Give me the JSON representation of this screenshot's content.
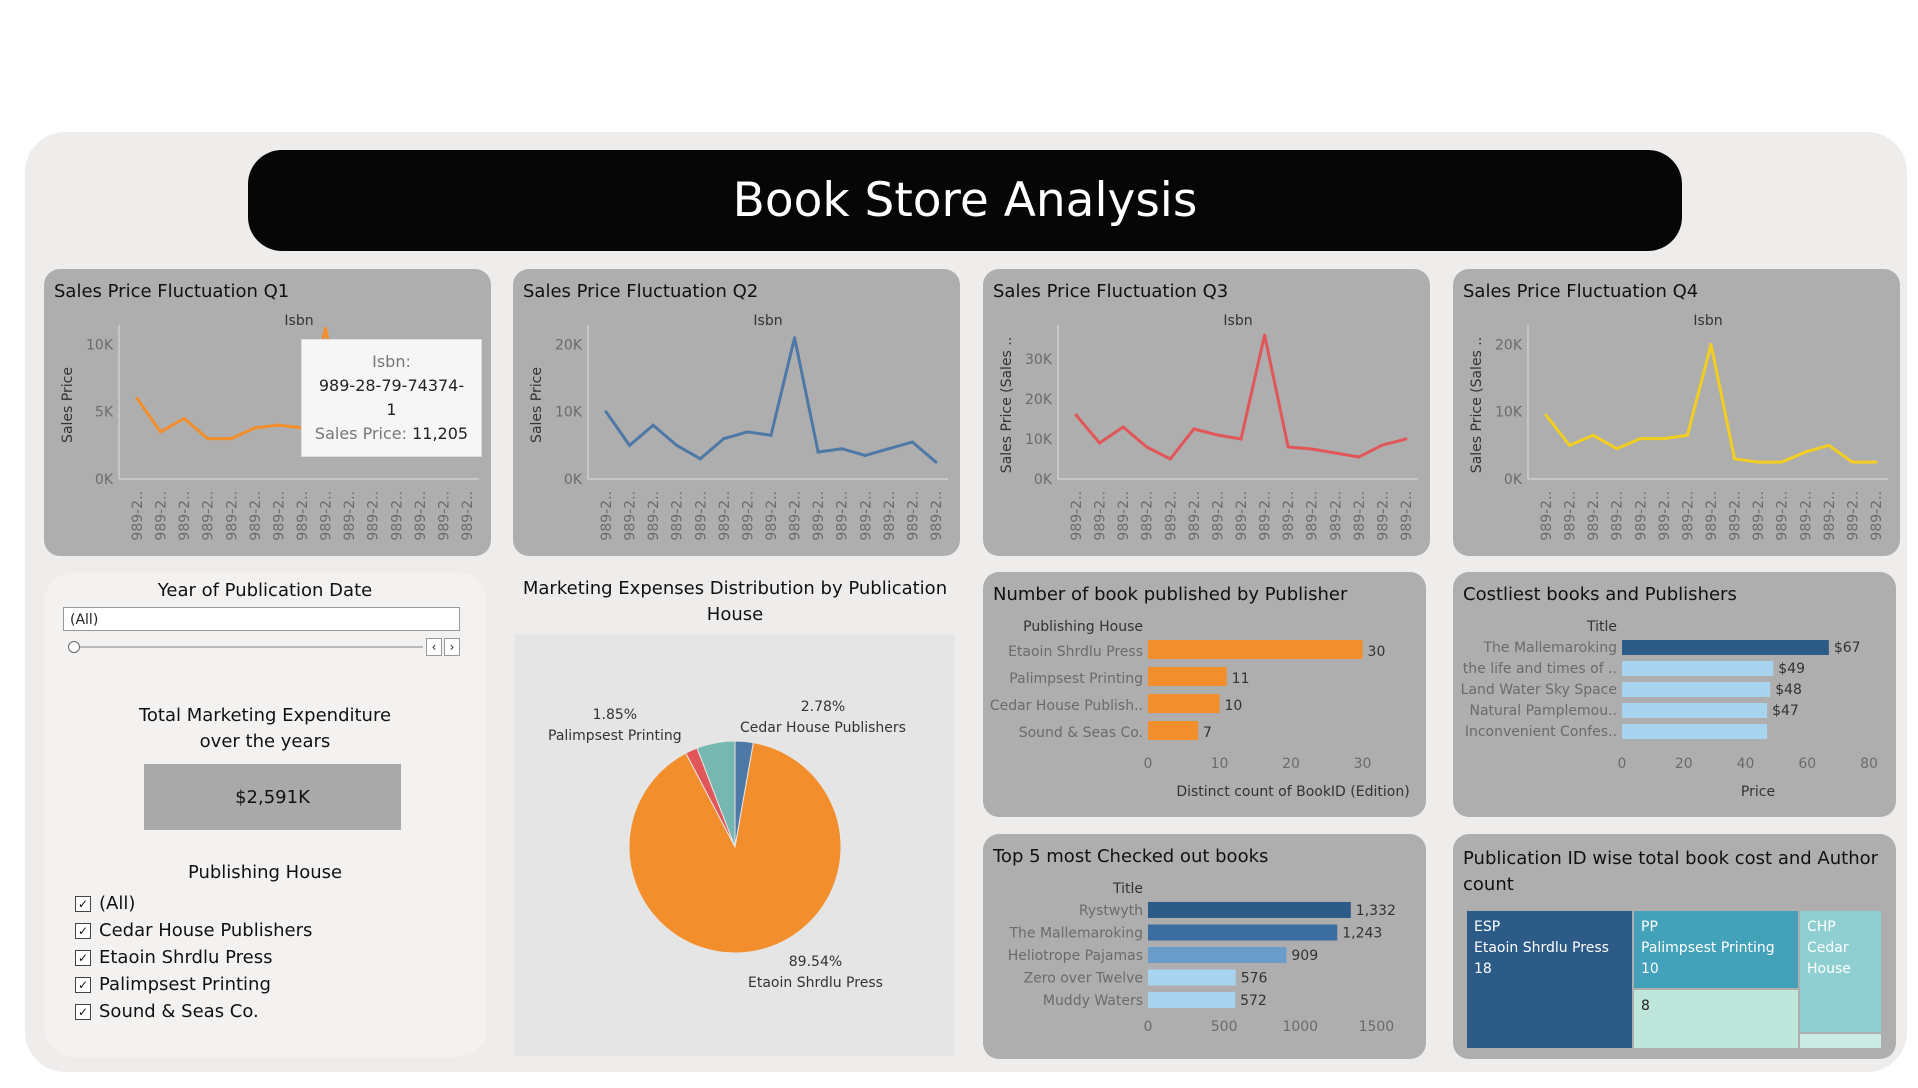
{
  "header": {
    "title": "Book Store Analysis"
  },
  "quarters": [
    {
      "title": "Sales Price Fluctuation  Q1",
      "xlabel": "Isbn",
      "ylabel": "Sales Price",
      "color": "#f28e2b",
      "ticks": [
        "10K",
        "5K",
        "0K"
      ],
      "ylim": [
        0,
        11000
      ],
      "tickvals": [
        10000,
        5000,
        0
      ],
      "values": [
        6000,
        3500,
        4500,
        3000,
        3000,
        3800,
        4000,
        3800,
        11205,
        2000,
        3000,
        2000,
        2500,
        2800,
        3200
      ],
      "xtick": "989-2.."
    },
    {
      "title": "Sales Price Fluctuation  Q2",
      "xlabel": "Isbn",
      "ylabel": "Sales Price",
      "color": "#4e79a7",
      "ticks": [
        "20K",
        "10K",
        "0K"
      ],
      "ylim": [
        0,
        22000
      ],
      "tickvals": [
        20000,
        10000,
        0
      ],
      "values": [
        10000,
        5000,
        8000,
        5000,
        3000,
        6000,
        7000,
        6500,
        21000,
        4000,
        4500,
        3500,
        4500,
        5500,
        2500
      ],
      "xtick": "989-2.."
    },
    {
      "title": "Sales Price Fluctuation Q3",
      "xlabel": "Isbn",
      "ylabel": "Sales Price (Sales ..",
      "color": "#e15759",
      "ticks": [
        "30K",
        "20K",
        "10K",
        "0K"
      ],
      "ylim": [
        0,
        37000
      ],
      "tickvals": [
        30000,
        20000,
        10000,
        0
      ],
      "values": [
        16000,
        9000,
        13000,
        8000,
        5000,
        12500,
        11000,
        10000,
        36000,
        8000,
        7500,
        6500,
        5500,
        8500,
        10000
      ],
      "xtick": "989-2.."
    },
    {
      "title": "Sales Price Fluctuation Q4",
      "xlabel": "Isbn",
      "ylabel": "Sales Price (Sales ..",
      "color": "#f1ce21",
      "ticks": [
        "20K",
        "10K",
        "0K"
      ],
      "ylim": [
        0,
        22000
      ],
      "tickvals": [
        20000,
        10000,
        0
      ],
      "values": [
        9500,
        5000,
        6500,
        4500,
        6000,
        6000,
        6500,
        20000,
        3000,
        2500,
        2500,
        4000,
        5000,
        2500,
        2500
      ],
      "xtick": "989-2.."
    }
  ],
  "tooltip": {
    "isbn_label": "Isbn:",
    "isbn_value": "989-28-79-74374-1",
    "price_label": "Sales Price:",
    "price_value": "11,205"
  },
  "filters": {
    "year_title": "Year of Publication Date",
    "year_value": "(All)",
    "total_title_1": "Total Marketing Expenditure",
    "total_title_2": "over the years",
    "total_value": "$2,591K",
    "publisher_title": "Publishing House",
    "publishers": [
      "(All)",
      "Cedar House Publishers",
      "Etaoin Shrdlu Press",
      "Palimpsest Printing",
      "Sound & Seas Co."
    ],
    "check_mark": "✓"
  },
  "pie": {
    "title_1": "Marketing Expenses Distribution by Publication",
    "title_2": "House",
    "labels": [
      {
        "pct": "2.78%",
        "name": "Cedar House Publishers"
      },
      {
        "pct": "1.85%",
        "name": "Palimpsest Printing"
      },
      {
        "pct": "89.54%",
        "name": "Etaoin Shrdlu Press"
      }
    ]
  },
  "chart_data": [
    {
      "type": "line",
      "title": "Sales Price Fluctuation  Q1",
      "xlabel": "Isbn",
      "ylabel": "Sales Price",
      "ylim": [
        0,
        11000
      ],
      "y": [
        6000,
        3500,
        4500,
        3000,
        3000,
        3800,
        4000,
        3800,
        11205,
        2000,
        3000,
        2000,
        2500,
        2800,
        3200
      ]
    },
    {
      "type": "line",
      "title": "Sales Price Fluctuation  Q2",
      "xlabel": "Isbn",
      "ylabel": "Sales Price",
      "ylim": [
        0,
        22000
      ],
      "y": [
        10000,
        5000,
        8000,
        5000,
        3000,
        6000,
        7000,
        6500,
        21000,
        4000,
        4500,
        3500,
        4500,
        5500,
        2500
      ]
    },
    {
      "type": "line",
      "title": "Sales Price Fluctuation Q3",
      "xlabel": "Isbn",
      "ylabel": "Sales Price (Sales ..",
      "ylim": [
        0,
        37000
      ],
      "y": [
        16000,
        9000,
        13000,
        8000,
        5000,
        12500,
        11000,
        10000,
        36000,
        8000,
        7500,
        6500,
        5500,
        8500,
        10000
      ]
    },
    {
      "type": "line",
      "title": "Sales Price Fluctuation Q4",
      "xlabel": "Isbn",
      "ylabel": "Sales Price (Sales ..",
      "ylim": [
        0,
        22000
      ],
      "y": [
        9500,
        5000,
        6500,
        4500,
        6000,
        6000,
        6500,
        20000,
        3000,
        2500,
        2500,
        4000,
        5000,
        2500,
        2500
      ]
    },
    {
      "type": "pie",
      "title": "Marketing Expenses Distribution by Publication House",
      "slices": [
        {
          "name": "Cedar House Publishers",
          "value": 2.78,
          "color": "#4e79a7"
        },
        {
          "name": "Etaoin Shrdlu Press",
          "value": 89.54,
          "color": "#f28e2b"
        },
        {
          "name": "Palimpsest Printing",
          "value": 1.85,
          "color": "#e15759"
        },
        {
          "name": "Sound & Seas Co.",
          "value": 5.83,
          "color": "#76b7b2"
        }
      ]
    },
    {
      "type": "bar",
      "title": "Number of book published by Publisher",
      "category_header": "Publishing House",
      "categories": [
        "Etaoin Shrdlu Press",
        "Palimpsest Printing",
        "Cedar House Publish..",
        "Sound & Seas Co."
      ],
      "values": [
        30,
        11,
        10,
        7
      ],
      "labels": [
        "30",
        "11",
        "10",
        "7"
      ],
      "xlabel": "Distinct count of BookID (Edition)",
      "ticks": [
        "0",
        "10",
        "20",
        "30"
      ],
      "xlim": [
        0,
        33
      ],
      "color": "#f28e2b"
    },
    {
      "type": "bar",
      "title": "Costliest books and Publishers",
      "category_header": "Title",
      "categories": [
        "The Mallemaroking",
        "the life and times of ..",
        "Land Water Sky Space",
        "Natural Pamplemou..",
        "Inconvenient Confes.."
      ],
      "values": [
        67,
        49,
        48,
        47,
        47
      ],
      "labels": [
        "$67",
        "$49",
        "$48",
        "$47",
        ""
      ],
      "xlabel": "Price",
      "ticks": [
        "0",
        "20",
        "40",
        "60",
        "80"
      ],
      "xlim": [
        0,
        80
      ],
      "colors": [
        "#2d5b87",
        "#a8d4ef",
        "#a8d4ef",
        "#a8d4ef",
        "#a8d4ef"
      ]
    },
    {
      "type": "bar",
      "title": "Top 5 most Checked out books",
      "category_header": "Title",
      "categories": [
        "Rystwyth",
        "The Mallemaroking",
        "Heliotrope Pajamas",
        "Zero over Twelve",
        "Muddy Waters"
      ],
      "values": [
        1332,
        1243,
        909,
        576,
        572
      ],
      "labels": [
        "1,332",
        "1,243",
        "909",
        "576",
        "572"
      ],
      "ticks": [
        "0",
        "500",
        "1000",
        "1500"
      ],
      "xlim": [
        0,
        1550
      ],
      "colors": [
        "#2d5b87",
        "#3a6ea0",
        "#6a9ccb",
        "#a8d4ef",
        "#a8d4ef"
      ]
    },
    {
      "type": "heatmap",
      "title": "Publication ID wise total book cost and Author count",
      "cells": [
        {
          "code": "ESP",
          "name": "Etaoin Shrdlu Press",
          "count": "18",
          "color": "#2d5b87"
        },
        {
          "code": "PP",
          "name": "Palimpsest Printing",
          "count": "10",
          "color": "#43a1ba"
        },
        {
          "code": "CHP",
          "name": "Cedar House",
          "count": "",
          "color": "#8fcfd1"
        },
        {
          "code": "",
          "name": "",
          "count": "8",
          "color": "#bfe6da"
        }
      ]
    }
  ]
}
